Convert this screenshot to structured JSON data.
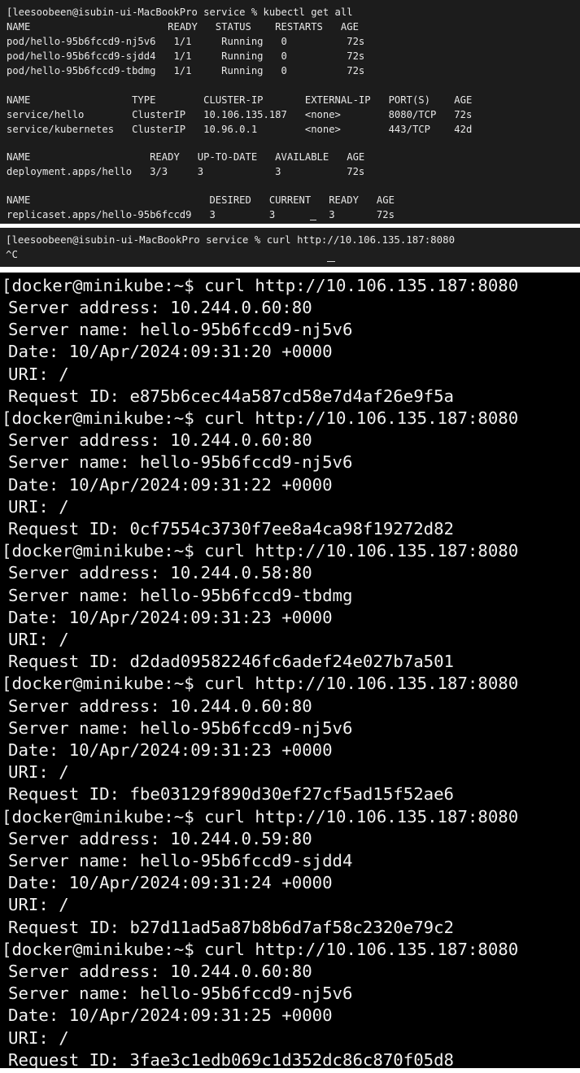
{
  "kubectl_panel": {
    "lines": [
      "[leesoobeen@isubin-ui-MacBookPro service % kubectl get all",
      "NAME                       READY   STATUS    RESTARTS   AGE",
      "pod/hello-95b6fccd9-nj5v6   1/1     Running   0          72s",
      "pod/hello-95b6fccd9-sjdd4   1/1     Running   0          72s",
      "pod/hello-95b6fccd9-tbdmg   1/1     Running   0          72s",
      "",
      "NAME                 TYPE        CLUSTER-IP       EXTERNAL-IP   PORT(S)    AGE",
      "service/hello        ClusterIP   10.106.135.187   <none>        8080/TCP   72s",
      "service/kubernetes   ClusterIP   10.96.0.1        <none>        443/TCP    42d",
      "",
      "NAME                    READY   UP-TO-DATE   AVAILABLE   AGE",
      "deployment.apps/hello   3/3     3            3           72s",
      "",
      "NAME                              DESIRED   CURRENT   READY   AGE",
      "replicaset.apps/hello-95b6fccd9   3         3         3       72s"
    ]
  },
  "mac_curl_panel": {
    "lines": [
      "[leesoobeen@isubin-ui-MacBookPro service % curl http://10.106.135.187:8080",
      "^C"
    ]
  },
  "minikube_panel": {
    "lines": [
      "[docker@minikube:~$ curl http://10.106.135.187:8080",
      "Server address: 10.244.0.60:80",
      "Server name: hello-95b6fccd9-nj5v6",
      "Date: 10/Apr/2024:09:31:20 +0000",
      "URI: /",
      "Request ID: e875b6cec44a587cd58e7d4af26e9f5a",
      "[docker@minikube:~$ curl http://10.106.135.187:8080",
      "Server address: 10.244.0.60:80",
      "Server name: hello-95b6fccd9-nj5v6",
      "Date: 10/Apr/2024:09:31:22 +0000",
      "URI: /",
      "Request ID: 0cf7554c3730f7ee8a4ca98f19272d82",
      "[docker@minikube:~$ curl http://10.106.135.187:8080",
      "Server address: 10.244.0.58:80",
      "Server name: hello-95b6fccd9-tbdmg",
      "Date: 10/Apr/2024:09:31:23 +0000",
      "URI: /",
      "Request ID: d2dad09582246fc6adef24e027b7a501",
      "[docker@minikube:~$ curl http://10.106.135.187:8080",
      "Server address: 10.244.0.60:80",
      "Server name: hello-95b6fccd9-nj5v6",
      "Date: 10/Apr/2024:09:31:23 +0000",
      "URI: /",
      "Request ID: fbe03129f890d30ef27cf5ad15f52ae6",
      "[docker@minikube:~$ curl http://10.106.135.187:8080",
      "Server address: 10.244.0.59:80",
      "Server name: hello-95b6fccd9-sjdd4",
      "Date: 10/Apr/2024:09:31:24 +0000",
      "URI: /",
      "Request ID: b27d11ad5a87b8b6d7af58c2320e79c2",
      "[docker@minikube:~$ curl http://10.106.135.187:8080",
      "Server address: 10.244.0.60:80",
      "Server name: hello-95b6fccd9-nj5v6",
      "Date: 10/Apr/2024:09:31:25 +0000",
      "URI: /",
      "Request ID: 3fae3c1edb069c1d352dc86c870f05d8"
    ]
  }
}
